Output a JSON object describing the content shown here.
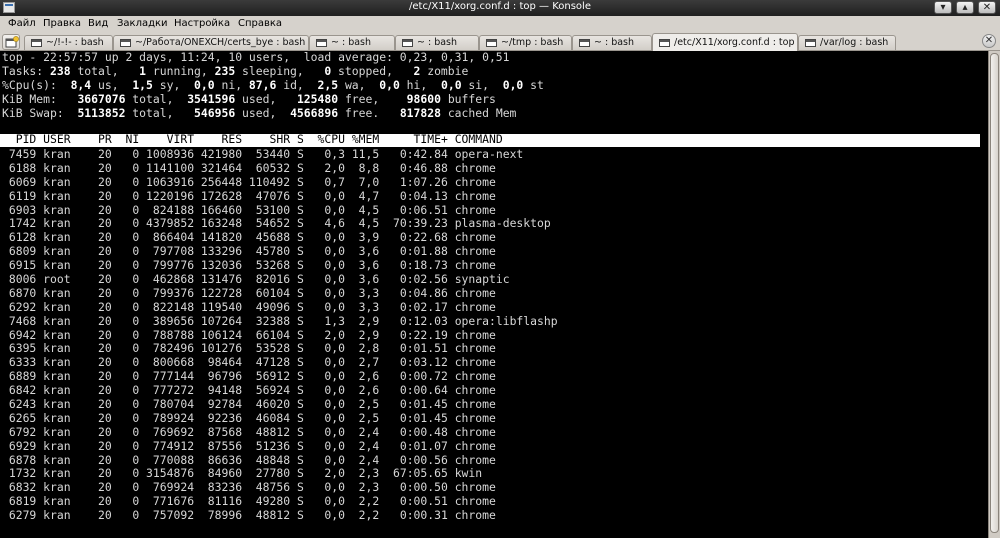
{
  "window": {
    "title": "/etc/X11/xorg.conf.d : top — Konsole"
  },
  "menu": [
    "Файл",
    "Правка",
    "Вид",
    "Закладки",
    "Настройка",
    "Справка"
  ],
  "tabs": [
    "~/!-!- : bash",
    "~/Работа/ONEXCH/certs_bye : bash",
    "~ : bash",
    "~ : bash",
    "~/tmp : bash",
    "~ : bash",
    "/etc/X11/xorg.conf.d : top",
    "/var/log : bash"
  ],
  "active_tab_index": 6,
  "top": {
    "uptime": {
      "time": "22:57:57",
      "up": "2 days, 11:24",
      "users": "10",
      "load_average": "0,23, 0,31, 0,51"
    },
    "tasks": {
      "total": "238",
      "running": "1",
      "sleeping": "235",
      "stopped": "0",
      "zombie": "2"
    },
    "cpu": {
      "us": "8,4",
      "sy": "1,5",
      "ni": "0,0",
      "id": "87,6",
      "wa": "2,5",
      "hi": "0,0",
      "si": "0,0",
      "st": "0,0"
    },
    "mem": {
      "total": "3667076",
      "used": "3541596",
      "free": "125480",
      "buffers": "98600"
    },
    "swap": {
      "total": "5113852",
      "used": "546956",
      "free": "4566896",
      "cached": "817828"
    },
    "columns": [
      "PID",
      "USER",
      "PR",
      "NI",
      "VIRT",
      "RES",
      "SHR",
      "S",
      "%CPU",
      "%MEM",
      "TIME+",
      "COMMAND"
    ],
    "processes": [
      [
        "7459",
        "kran",
        "20",
        "0",
        "1008936",
        "421980",
        "53440",
        "S",
        "0,3",
        "11,5",
        "0:42.84",
        "opera-next"
      ],
      [
        "6188",
        "kran",
        "20",
        "0",
        "1141100",
        "321464",
        "60532",
        "S",
        "2,0",
        "8,8",
        "0:46.88",
        "chrome"
      ],
      [
        "6069",
        "kran",
        "20",
        "0",
        "1063916",
        "256448",
        "110492",
        "S",
        "0,7",
        "7,0",
        "1:07.26",
        "chrome"
      ],
      [
        "6119",
        "kran",
        "20",
        "0",
        "1220196",
        "172628",
        "47076",
        "S",
        "0,0",
        "4,7",
        "0:04.13",
        "chrome"
      ],
      [
        "6903",
        "kran",
        "20",
        "0",
        "824188",
        "166460",
        "53100",
        "S",
        "0,0",
        "4,5",
        "0:06.51",
        "chrome"
      ],
      [
        "1742",
        "kran",
        "20",
        "0",
        "4379852",
        "163248",
        "54652",
        "S",
        "4,6",
        "4,5",
        "70:39.23",
        "plasma-desktop"
      ],
      [
        "6128",
        "kran",
        "20",
        "0",
        "866404",
        "141820",
        "45688",
        "S",
        "0,0",
        "3,9",
        "0:22.68",
        "chrome"
      ],
      [
        "6809",
        "kran",
        "20",
        "0",
        "797708",
        "133296",
        "45780",
        "S",
        "0,0",
        "3,6",
        "0:01.88",
        "chrome"
      ],
      [
        "6915",
        "kran",
        "20",
        "0",
        "799776",
        "132036",
        "53268",
        "S",
        "0,0",
        "3,6",
        "0:18.73",
        "chrome"
      ],
      [
        "8006",
        "root",
        "20",
        "0",
        "462868",
        "131476",
        "82016",
        "S",
        "0,0",
        "3,6",
        "0:02.56",
        "synaptic"
      ],
      [
        "6870",
        "kran",
        "20",
        "0",
        "799376",
        "122728",
        "60104",
        "S",
        "0,0",
        "3,3",
        "0:04.86",
        "chrome"
      ],
      [
        "6292",
        "kran",
        "20",
        "0",
        "822148",
        "119540",
        "49096",
        "S",
        "0,0",
        "3,3",
        "0:02.17",
        "chrome"
      ],
      [
        "7468",
        "kran",
        "20",
        "0",
        "389656",
        "107264",
        "32388",
        "S",
        "1,3",
        "2,9",
        "0:12.03",
        "opera:libflashp"
      ],
      [
        "6942",
        "kran",
        "20",
        "0",
        "788788",
        "106124",
        "66104",
        "S",
        "2,0",
        "2,9",
        "0:22.19",
        "chrome"
      ],
      [
        "6395",
        "kran",
        "20",
        "0",
        "782496",
        "101276",
        "53528",
        "S",
        "0,0",
        "2,8",
        "0:01.51",
        "chrome"
      ],
      [
        "6333",
        "kran",
        "20",
        "0",
        "800668",
        "98464",
        "47128",
        "S",
        "0,0",
        "2,7",
        "0:03.12",
        "chrome"
      ],
      [
        "6889",
        "kran",
        "20",
        "0",
        "777144",
        "96796",
        "56912",
        "S",
        "0,0",
        "2,6",
        "0:00.72",
        "chrome"
      ],
      [
        "6842",
        "kran",
        "20",
        "0",
        "777272",
        "94148",
        "56924",
        "S",
        "0,0",
        "2,6",
        "0:00.64",
        "chrome"
      ],
      [
        "6243",
        "kran",
        "20",
        "0",
        "780704",
        "92784",
        "46020",
        "S",
        "0,0",
        "2,5",
        "0:01.45",
        "chrome"
      ],
      [
        "6265",
        "kran",
        "20",
        "0",
        "789924",
        "92236",
        "46084",
        "S",
        "0,0",
        "2,5",
        "0:01.45",
        "chrome"
      ],
      [
        "6792",
        "kran",
        "20",
        "0",
        "769692",
        "87568",
        "48812",
        "S",
        "0,0",
        "2,4",
        "0:00.48",
        "chrome"
      ],
      [
        "6929",
        "kran",
        "20",
        "0",
        "774912",
        "87556",
        "51236",
        "S",
        "0,0",
        "2,4",
        "0:01.07",
        "chrome"
      ],
      [
        "6878",
        "kran",
        "20",
        "0",
        "770088",
        "86636",
        "48848",
        "S",
        "0,0",
        "2,4",
        "0:00.56",
        "chrome"
      ],
      [
        "1732",
        "kran",
        "20",
        "0",
        "3154876",
        "84960",
        "27780",
        "S",
        "2,0",
        "2,3",
        "67:05.65",
        "kwin"
      ],
      [
        "6832",
        "kran",
        "20",
        "0",
        "769924",
        "83236",
        "48756",
        "S",
        "0,0",
        "2,3",
        "0:00.50",
        "chrome"
      ],
      [
        "6819",
        "kran",
        "20",
        "0",
        "771676",
        "81116",
        "49280",
        "S",
        "0,0",
        "2,2",
        "0:00.51",
        "chrome"
      ],
      [
        "6279",
        "kran",
        "20",
        "0",
        "757092",
        "78996",
        "48812",
        "S",
        "0,0",
        "2,2",
        "0:00.31",
        "chrome"
      ]
    ]
  }
}
